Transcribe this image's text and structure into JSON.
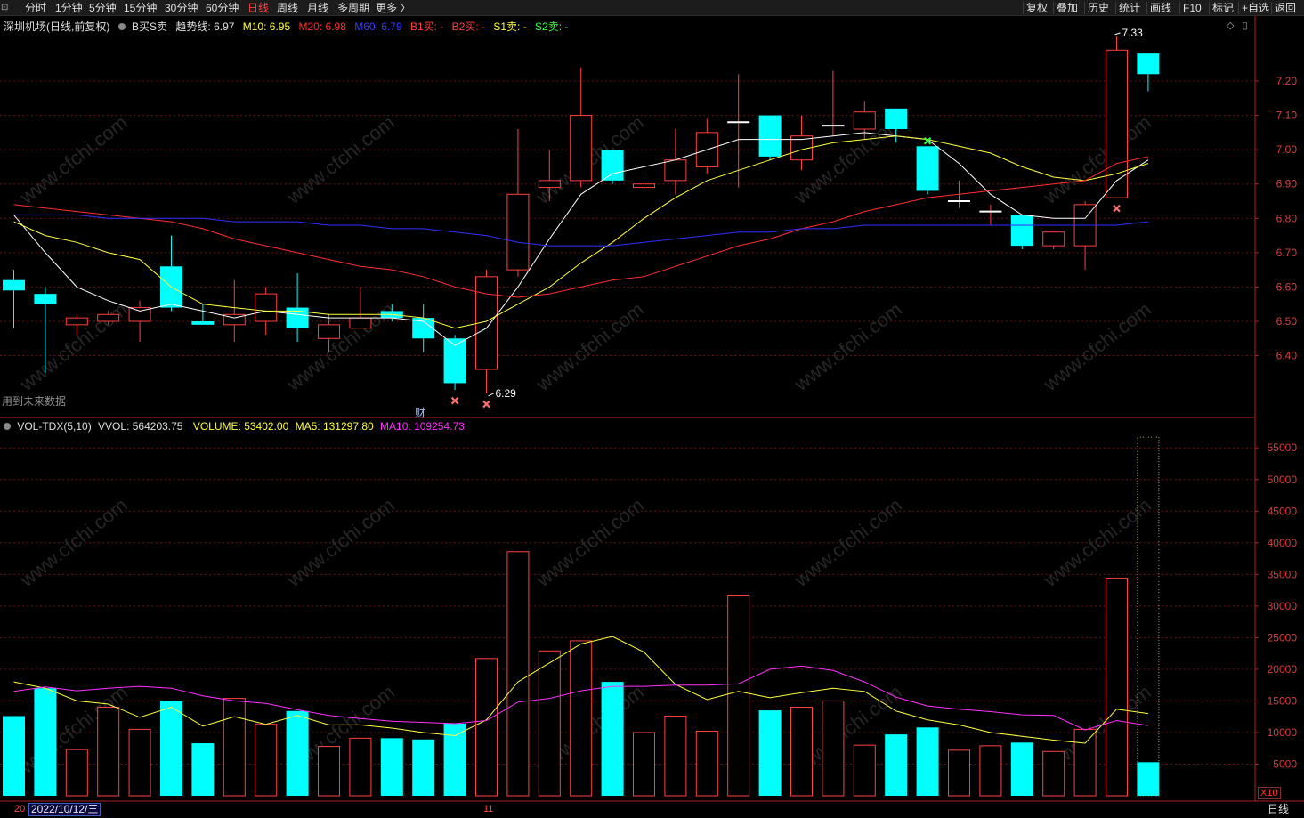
{
  "toolbar": {
    "periods": [
      "分时",
      "1分钟",
      "5分钟",
      "15分钟",
      "30分钟",
      "60分钟",
      "日线",
      "周线",
      "月线",
      "多周期",
      "更多 〉"
    ],
    "active_period": "日线",
    "right_buttons": [
      "复权",
      "叠加",
      "历史",
      "统计",
      "画线",
      "F10",
      "标记",
      "+自选",
      "返回"
    ]
  },
  "main_panel": {
    "stock_title": "深圳机场(日线,前复权)",
    "indicator_name": "B买S卖",
    "trend": {
      "label": "趋势线:",
      "value": "6.97"
    },
    "m10": {
      "label": "M10:",
      "value": "6.95"
    },
    "m20": {
      "label": "M20:",
      "value": "6.98"
    },
    "m60": {
      "label": "M60:",
      "value": "6.79"
    },
    "b1": "B1买: -",
    "b2": "B2买: -",
    "s1": "S1卖: -",
    "s2": "S2卖: -",
    "future_note": "用到未来数据",
    "high_marker": "7.33",
    "low_marker": "6.29",
    "event_badge": "财"
  },
  "volume_panel": {
    "indicator": "VOL-TDX(5,10)",
    "vvol": {
      "label": "VVOL:",
      "value": "564203.75"
    },
    "volume": {
      "label": "VOLUME:",
      "value": "53402.00"
    },
    "ma5": {
      "label": "MA5:",
      "value": "131297.80"
    },
    "ma10": {
      "label": "MA10:",
      "value": "109254.73"
    },
    "unit_label": "X10"
  },
  "bottom_bar": {
    "date_prefix": "20",
    "cursor_date": "2022/10/12/三",
    "month_mark": "11",
    "period_label": "日线"
  },
  "colors": {
    "up": "#ff4040",
    "down": "#00ffff",
    "trend_line": "#ffffff",
    "m10": "#ffff40",
    "m20": "#ff3030",
    "m60": "#3030ff",
    "ma5": "#ffff40",
    "ma10": "#ff30ff",
    "axis": "#b02020"
  },
  "chart_data": [
    {
      "type": "candlestick",
      "price_axis_ticks": [
        "7.20",
        "7.10",
        "7.00",
        "6.90",
        "6.80",
        "6.70",
        "6.60",
        "6.50",
        "6.40"
      ],
      "ylim": [
        6.2,
        7.35
      ],
      "candles": [
        {
          "o": 6.62,
          "h": 6.65,
          "l": 6.48,
          "c": 6.59
        },
        {
          "o": 6.58,
          "h": 6.6,
          "l": 6.35,
          "c": 6.55
        },
        {
          "o": 6.49,
          "h": 6.52,
          "l": 6.46,
          "c": 6.51
        },
        {
          "o": 6.5,
          "h": 6.53,
          "l": 6.49,
          "c": 6.52
        },
        {
          "o": 6.5,
          "h": 6.56,
          "l": 6.44,
          "c": 6.54
        },
        {
          "o": 6.66,
          "h": 6.75,
          "l": 6.53,
          "c": 6.54
        },
        {
          "o": 6.5,
          "h": 6.55,
          "l": 6.49,
          "c": 6.49
        },
        {
          "o": 6.49,
          "h": 6.62,
          "l": 6.44,
          "c": 6.52
        },
        {
          "o": 6.5,
          "h": 6.6,
          "l": 6.46,
          "c": 6.58
        },
        {
          "o": 6.54,
          "h": 6.64,
          "l": 6.44,
          "c": 6.48
        },
        {
          "o": 6.45,
          "h": 6.52,
          "l": 6.41,
          "c": 6.49
        },
        {
          "o": 6.48,
          "h": 6.6,
          "l": 6.48,
          "c": 6.51
        },
        {
          "o": 6.53,
          "h": 6.55,
          "l": 6.5,
          "c": 6.51
        },
        {
          "o": 6.51,
          "h": 6.55,
          "l": 6.41,
          "c": 6.45
        },
        {
          "o": 6.45,
          "h": 6.46,
          "l": 6.3,
          "c": 6.32
        },
        {
          "o": 6.36,
          "h": 6.65,
          "l": 6.29,
          "c": 6.63
        },
        {
          "o": 6.65,
          "h": 7.06,
          "l": 6.63,
          "c": 6.87
        },
        {
          "o": 6.89,
          "h": 7.0,
          "l": 6.85,
          "c": 6.91
        },
        {
          "o": 6.91,
          "h": 7.24,
          "l": 6.89,
          "c": 7.1
        },
        {
          "o": 7.0,
          "h": 7.0,
          "l": 6.9,
          "c": 6.91
        },
        {
          "o": 6.89,
          "h": 6.92,
          "l": 6.88,
          "c": 6.9
        },
        {
          "o": 6.91,
          "h": 7.06,
          "l": 6.87,
          "c": 6.97
        },
        {
          "o": 6.95,
          "h": 7.09,
          "l": 6.93,
          "c": 7.05
        },
        {
          "o": 7.08,
          "h": 7.22,
          "l": 6.89,
          "c": 7.08
        },
        {
          "o": 7.1,
          "h": 7.1,
          "l": 6.97,
          "c": 6.98
        },
        {
          "o": 6.97,
          "h": 7.1,
          "l": 6.94,
          "c": 7.04
        },
        {
          "o": 7.07,
          "h": 7.23,
          "l": 7.04,
          "c": 7.07
        },
        {
          "o": 7.06,
          "h": 7.14,
          "l": 7.03,
          "c": 7.11
        },
        {
          "o": 7.12,
          "h": 7.12,
          "l": 7.02,
          "c": 7.06
        },
        {
          "o": 7.01,
          "h": 7.01,
          "l": 6.87,
          "c": 6.88
        },
        {
          "o": 6.85,
          "h": 6.91,
          "l": 6.83,
          "c": 6.85
        },
        {
          "o": 6.82,
          "h": 6.84,
          "l": 6.78,
          "c": 6.82
        },
        {
          "o": 6.81,
          "h": 6.81,
          "l": 6.71,
          "c": 6.72
        },
        {
          "o": 6.72,
          "h": 6.76,
          "l": 6.71,
          "c": 6.76
        },
        {
          "o": 6.72,
          "h": 6.85,
          "l": 6.65,
          "c": 6.84
        },
        {
          "o": 6.86,
          "h": 7.33,
          "l": 6.86,
          "c": 7.29
        },
        {
          "o": 7.28,
          "h": 7.28,
          "l": 7.17,
          "c": 7.22
        }
      ],
      "series": [
        {
          "name": "趋势线",
          "values": [
            6.81,
            6.7,
            6.6,
            6.56,
            6.53,
            6.55,
            6.53,
            6.51,
            6.53,
            6.52,
            6.51,
            6.51,
            6.51,
            6.5,
            6.43,
            6.48,
            6.6,
            6.74,
            6.87,
            6.93,
            6.95,
            6.97,
            7.0,
            7.03,
            7.03,
            7.03,
            7.04,
            7.05,
            7.04,
            7.03,
            6.96,
            6.87,
            6.81,
            6.8,
            6.8,
            6.91,
            6.97
          ]
        },
        {
          "name": "M10",
          "values": [
            6.79,
            6.75,
            6.73,
            6.7,
            6.68,
            6.6,
            6.55,
            6.54,
            6.53,
            6.53,
            6.52,
            6.52,
            6.52,
            6.51,
            6.48,
            6.5,
            6.55,
            6.6,
            6.67,
            6.73,
            6.8,
            6.86,
            6.91,
            6.94,
            6.97,
            7.0,
            7.02,
            7.03,
            7.04,
            7.03,
            7.01,
            6.99,
            6.95,
            6.92,
            6.91,
            6.93,
            6.96
          ]
        },
        {
          "name": "M20",
          "values": [
            6.84,
            6.83,
            6.82,
            6.81,
            6.8,
            6.79,
            6.77,
            6.74,
            6.72,
            6.7,
            6.68,
            6.66,
            6.65,
            6.63,
            6.6,
            6.58,
            6.57,
            6.58,
            6.6,
            6.62,
            6.63,
            6.66,
            6.69,
            6.72,
            6.74,
            6.77,
            6.79,
            6.82,
            6.84,
            6.86,
            6.87,
            6.88,
            6.89,
            6.9,
            6.91,
            6.96,
            6.98
          ]
        },
        {
          "name": "M60",
          "values": [
            6.81,
            6.81,
            6.81,
            6.8,
            6.8,
            6.8,
            6.8,
            6.79,
            6.79,
            6.79,
            6.78,
            6.78,
            6.77,
            6.77,
            6.76,
            6.75,
            6.73,
            6.72,
            6.72,
            6.72,
            6.73,
            6.74,
            6.75,
            6.76,
            6.76,
            6.77,
            6.77,
            6.78,
            6.78,
            6.78,
            6.78,
            6.78,
            6.78,
            6.78,
            6.78,
            6.78,
            6.79
          ]
        }
      ],
      "signals": [
        {
          "index": 14,
          "type": "sell-x"
        },
        {
          "index": 15,
          "type": "sell-x"
        },
        {
          "index": 29,
          "type": "buy-x"
        },
        {
          "index": 35,
          "type": "sell-x"
        }
      ]
    },
    {
      "type": "bar",
      "volume_axis_ticks": [
        "55000",
        "50000",
        "45000",
        "40000",
        "35000",
        "30000",
        "25000",
        "20000",
        "15000",
        "10000",
        "5000"
      ],
      "ylim": [
        0,
        58000
      ],
      "values": [
        12600,
        17000,
        7300,
        14000,
        10500,
        15000,
        8300,
        15400,
        11300,
        13400,
        7800,
        9100,
        9100,
        8900,
        11400,
        21700,
        38600,
        22900,
        24500,
        18000,
        10000,
        12600,
        10200,
        31600,
        13500,
        14000,
        15000,
        8000,
        9700,
        10800,
        7200,
        7900,
        8400,
        7000,
        10500,
        34400,
        5300
      ],
      "projected_last": 56700,
      "series": [
        {
          "name": "MA5",
          "values": [
            18000,
            17000,
            15000,
            14500,
            12400,
            14000,
            11000,
            12500,
            11300,
            12700,
            11200,
            11200,
            10700,
            10000,
            9500,
            12000,
            18000,
            21000,
            24000,
            25200,
            22700,
            17600,
            15200,
            16500,
            15500,
            16300,
            17000,
            16500,
            13400,
            12000,
            11200,
            10000,
            9400,
            8800,
            8300,
            13700,
            13000
          ]
        },
        {
          "name": "MA10",
          "values": [
            16500,
            17200,
            16600,
            17000,
            17300,
            17000,
            15800,
            15000,
            14600,
            13600,
            12700,
            12200,
            11800,
            11600,
            11400,
            11900,
            14800,
            15400,
            16600,
            17300,
            17300,
            17500,
            17500,
            17700,
            20000,
            20500,
            19800,
            18000,
            15600,
            14200,
            13700,
            13300,
            12800,
            12700,
            10400,
            11900,
            11100
          ]
        }
      ]
    }
  ]
}
